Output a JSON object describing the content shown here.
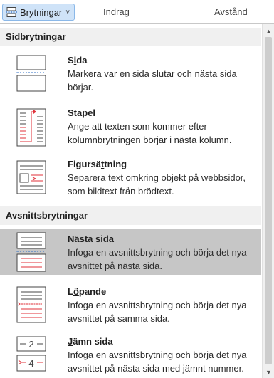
{
  "ribbon": {
    "breaks_button_label": "Brytningar",
    "chevron": "˅",
    "indent_label": "Indrag",
    "spacing_label": "Avstånd"
  },
  "menu": {
    "page_breaks_header": "Sidbrytningar",
    "section_breaks_header": "Avsnittsbrytningar",
    "items": [
      {
        "title_pre": "S",
        "title_key": "i",
        "title_post": "da",
        "desc1": "Markera var en sida slutar och nästa sida",
        "desc2": "börjar.",
        "icon": "page-break-icon"
      },
      {
        "title_pre": "",
        "title_key": "S",
        "title_post": "tapel",
        "desc1": "Ange att texten som kommer efter",
        "desc2": "kolumnbrytningen börjar i nästa kolumn.",
        "icon": "column-break-icon"
      },
      {
        "title_pre": "Figursä",
        "title_key": "t",
        "title_post": "tning",
        "desc1": "Separera text omkring objekt på webbsidor,",
        "desc2": "som bildtext från brödtext.",
        "icon": "text-wrapping-icon"
      },
      {
        "title_pre": "",
        "title_key": "N",
        "title_post": "ästa sida",
        "desc1": "Infoga en avsnittsbrytning och börja det nya",
        "desc2": "avsnittet på nästa sida.",
        "icon": "next-page-icon"
      },
      {
        "title_pre": "L",
        "title_key": "ö",
        "title_post": "pande",
        "desc1": "Infoga en avsnittsbrytning och börja det nya",
        "desc2": "avsnittet på samma sida.",
        "icon": "continuous-icon"
      },
      {
        "title_pre": "",
        "title_key": "J",
        "title_post": "ämn sida",
        "desc1": "Infoga en avsnittsbrytning och börja det nya",
        "desc2": "avsnittet på nästa sida med jämnt nummer.",
        "icon": "even-page-icon"
      }
    ]
  },
  "icon_glyphs": {
    "even_top": "2",
    "even_bottom": "4"
  },
  "scrollbar": {
    "up": "▲",
    "down": "▼"
  },
  "colors": {
    "accent_red": "#e0313a",
    "accent_blue": "#2b6cc4",
    "hover_bg": "#c6c6c6",
    "header_bg": "#f0f0f0",
    "button_bg": "#cfe3f8"
  }
}
